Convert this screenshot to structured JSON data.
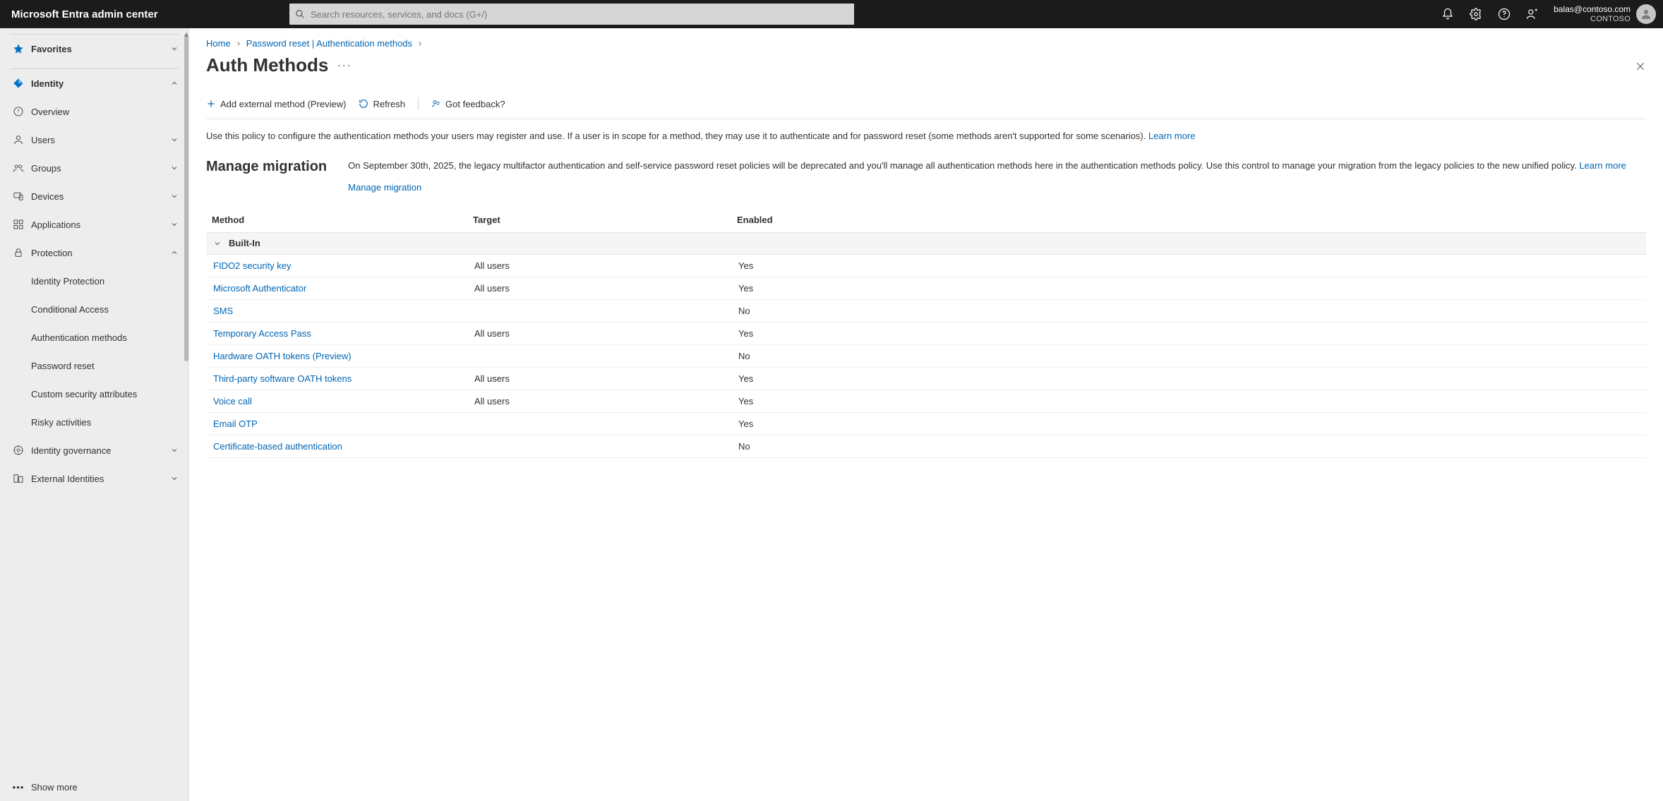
{
  "header": {
    "brand": "Microsoft Entra admin center",
    "search_placeholder": "Search resources, services, and docs (G+/)",
    "account_primary": "balas@contoso.com",
    "account_secondary": "CONTOSO"
  },
  "sidebar": {
    "favorites_label": "Favorites",
    "identity_label": "Identity",
    "items": [
      {
        "label": "Overview"
      },
      {
        "label": "Users"
      },
      {
        "label": "Groups"
      },
      {
        "label": "Devices"
      },
      {
        "label": "Applications"
      },
      {
        "label": "Protection"
      }
    ],
    "protection_subitems": [
      {
        "label": "Identity Protection"
      },
      {
        "label": "Conditional Access"
      },
      {
        "label": "Authentication methods"
      },
      {
        "label": "Password reset"
      },
      {
        "label": "Custom security attributes"
      },
      {
        "label": "Risky activities"
      }
    ],
    "post_items": [
      {
        "label": "Identity governance"
      },
      {
        "label": "External Identities"
      }
    ],
    "show_more_label": "Show more"
  },
  "breadcrumbs": {
    "home": "Home",
    "second": "Password reset | Authentication methods"
  },
  "page": {
    "title": "Auth Methods"
  },
  "commands": {
    "add": "Add external method (Preview)",
    "refresh": "Refresh",
    "feedback": "Got feedback?"
  },
  "policy": {
    "desc": "Use this policy to configure the authentication methods your users may register and use. If a user is in scope for a method, they may use it to authenticate and for password reset (some methods aren't supported for some scenarios). ",
    "learn_more": "Learn more"
  },
  "migration": {
    "title": "Manage migration",
    "desc": "On September 30th, 2025, the legacy multifactor authentication and self-service password reset policies will be deprecated and you'll manage all authentication methods here in the authentication methods policy. Use this control to manage your migration from the legacy policies to the new unified policy. ",
    "learn_more": "Learn more",
    "link": "Manage migration"
  },
  "table": {
    "headers": {
      "method": "Method",
      "target": "Target",
      "enabled": "Enabled"
    },
    "group_label": "Built-In",
    "rows": [
      {
        "method": "FIDO2 security key",
        "target": "All users",
        "enabled": "Yes"
      },
      {
        "method": "Microsoft Authenticator",
        "target": "All users",
        "enabled": "Yes"
      },
      {
        "method": "SMS",
        "target": "",
        "enabled": "No"
      },
      {
        "method": "Temporary Access Pass",
        "target": "All users",
        "enabled": "Yes"
      },
      {
        "method": "Hardware OATH tokens (Preview)",
        "target": "",
        "enabled": "No"
      },
      {
        "method": "Third-party software OATH tokens",
        "target": "All users",
        "enabled": "Yes"
      },
      {
        "method": "Voice call",
        "target": "All users",
        "enabled": "Yes"
      },
      {
        "method": "Email OTP",
        "target": "",
        "enabled": "Yes"
      },
      {
        "method": "Certificate-based authentication",
        "target": "",
        "enabled": "No"
      }
    ]
  }
}
